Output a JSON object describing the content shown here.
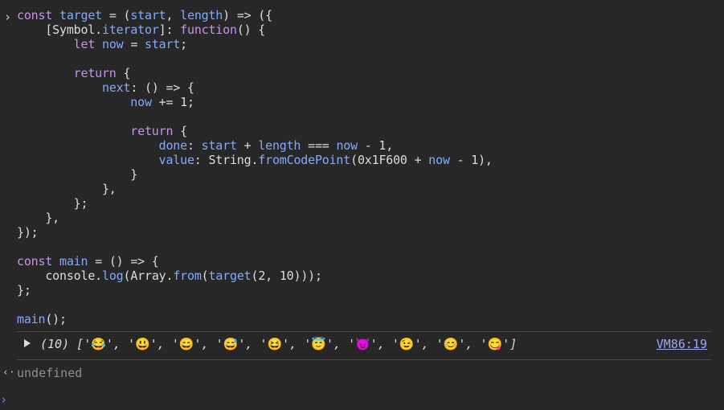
{
  "console": {
    "prompt_symbol": "›",
    "code_lines": [
      "const target = (start, length) => ({",
      "    [Symbol.iterator]: function() {",
      "        let now = start;",
      "",
      "        return {",
      "            next: () => {",
      "                now += 1;",
      "",
      "                return {",
      "                    done: start + length === now - 1,",
      "                    value: String.fromCodePoint(0x1F600 + now - 1),",
      "                }",
      "            },",
      "        };",
      "    },",
      "});",
      "",
      "const main = () => {",
      "    console.log(Array.from(target(2, 10)));",
      "};",
      "",
      "main();"
    ],
    "output": {
      "count_label": "(10)",
      "open_bracket": "[",
      "items": [
        "'😂'",
        "'😃'",
        "'😄'",
        "'😅'",
        "'😆'",
        "'😇'",
        "'😈'",
        "'😉'",
        "'😊'",
        "'😋'"
      ],
      "separator": ", ",
      "close_bracket": "]",
      "source_link": "VM86:19"
    },
    "result": {
      "arrow": "‹·",
      "value": "undefined"
    },
    "input_prompt": "›"
  },
  "colors": {
    "background": "#272727",
    "keyword": "#c792ea",
    "identifier": "#82aaff",
    "plain": "#dcdcdc",
    "link": "#9aa6f5",
    "muted": "#8e8e8e",
    "input_prompt": "#5c8fff"
  }
}
